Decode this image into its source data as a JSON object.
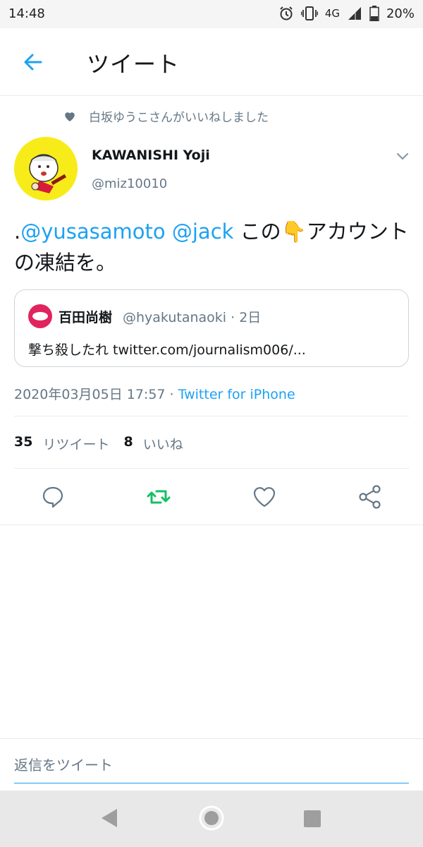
{
  "status_bar": {
    "time": "14:48",
    "network": "4G",
    "battery": "20%",
    "icons": [
      "alarm-icon",
      "vibrate-icon",
      "signal-icon",
      "battery-icon"
    ]
  },
  "header": {
    "title": "ツイート",
    "back_icon": "arrow-left-icon"
  },
  "social_context": {
    "text": "白坂ゆうこさんがいいねしました",
    "icon": "heart-icon"
  },
  "tweet": {
    "author_name": "KAWANISHI Yoji",
    "author_handle": "@miz10010",
    "text_prefix": ".",
    "mention1": "@yusasamoto",
    "mention2": "@jack",
    "text_rest": "この👇アカウントの凍結を。",
    "timestamp": "2020年03月05日 17:57",
    "separator": " · ",
    "source": "Twitter for iPhone"
  },
  "quoted_tweet": {
    "author_name": "百田尚樹",
    "author_handle": "@hyakutanaoki · 2日",
    "text": "撃ち殺したれ twitter.com/journalism006/..."
  },
  "stats": {
    "retweets_count": "35",
    "retweets_label": "リツイート",
    "likes_count": "8",
    "likes_label": "いいね"
  },
  "reply": {
    "placeholder": "返信をツイート"
  },
  "colors": {
    "accent": "#1da1f2",
    "retweet": "#17bf63",
    "secondary_text": "#657786",
    "divider": "#e6ecf0",
    "avatar_bg": "#f7ec1a",
    "quoted_avatar": "#e0245e"
  }
}
